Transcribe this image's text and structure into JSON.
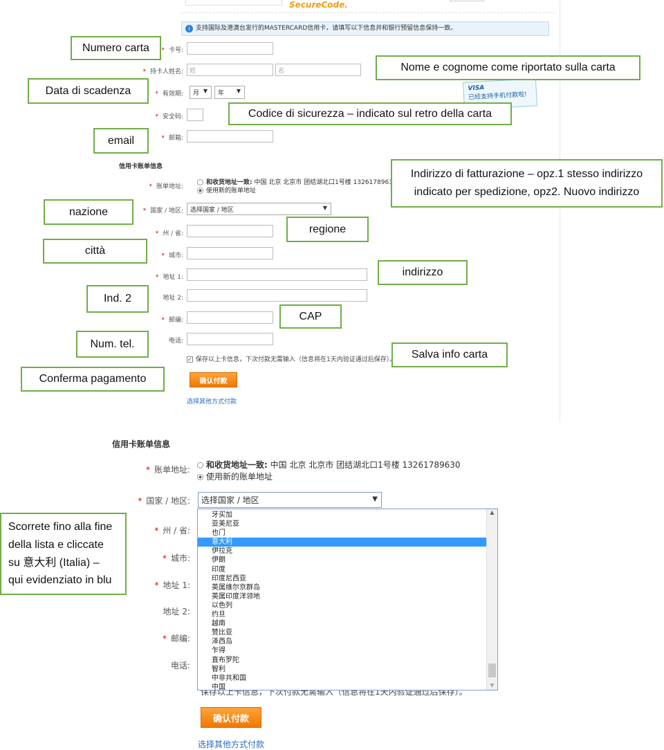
{
  "top_form": {
    "header_logo_text": "SecureCode.",
    "info_bar": "支持国际及港澳台发行的MASTERCARD信用卡，请填写以下信息并和银行预留信息保持一致。",
    "card_number_label": "卡号:",
    "holder_name_label": "持卡人姓名:",
    "surname_placeholder": "姓",
    "given_name_placeholder": "名",
    "expiry_label": "有效期:",
    "month_value": "月",
    "year_value": "年",
    "cvv_label": "安全码:",
    "email_label": "邮箱:",
    "visa_promo": "已经支持手机付款啦!",
    "visa_logo": "VISA",
    "billing_title": "信用卡账单信息",
    "billing_address_label": "账单地址:",
    "same_address_option": "和收货地址一致:",
    "same_address_value": "中国 北京 北京市 团结湖北口1号楼 13261789630",
    "new_address_option": "使用新的账单地址",
    "country_label": "国家 / 地区:",
    "country_value": "选择国家 / 地区",
    "province_label": "州 / 省:",
    "city_label": "城市:",
    "address1_label": "地址 1:",
    "address2_label": "地址 2:",
    "zip_label": "邮编:",
    "phone_label": "电话:",
    "save_info": "保存以上卡信息，下次付款无需输入（信息将在1天内验证通过后保存）。",
    "confirm_button": "确认付款",
    "other_method_link": "选择其他方式付款"
  },
  "annotations": {
    "card_number": "Numero carta",
    "name": "Nome e cognome come riportato sulla carta",
    "expiry": "Data di scadenza",
    "cvv": "Codice di sicurezza – indicato sul retro della carta",
    "email": "email",
    "billing_line1": "Indirizzo di fatturazione – opz.1 stesso indirizzo",
    "billing_line2": "indicato per spedizione, opz2. Nuovo indirizzo",
    "country": "nazione",
    "region": "regione",
    "city": "città",
    "address": "indirizzo",
    "address2": "Ind. 2",
    "zip": "CAP",
    "phone": "Num. tel.",
    "save": "Salva info carta",
    "confirm": "Conferma pagamento",
    "scroll_line1": "Scorrete fino alla fine",
    "scroll_line2": "della lista e cliccate",
    "scroll_line3": "su 意大利  (Italia) –",
    "scroll_line4": "qui evidenziato in blu"
  },
  "dropdown": {
    "selected": "意大利",
    "highlight_color": "#3399ff",
    "options": [
      "牙买加",
      "亚美尼亚",
      "也门",
      "意大利",
      "伊拉克",
      "伊朗",
      "印度",
      "印度尼西亚",
      "英属维尔京群岛",
      "英属印度洋领地",
      "以色列",
      "约旦",
      "越南",
      "赞比亚",
      "泽西岛",
      "乍得",
      "直布罗陀",
      "智利",
      "中非共和国",
      "中国"
    ]
  },
  "colors": {
    "annotation_border": "#70ad47",
    "button": "#f28a10",
    "link": "#2a6bc2"
  }
}
